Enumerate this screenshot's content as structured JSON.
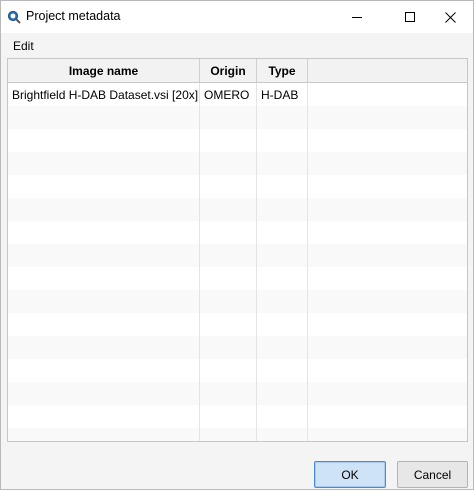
{
  "window": {
    "title": "Project metadata",
    "app_icon": "qupath-magnifier-icon"
  },
  "menu": {
    "items": [
      {
        "label": "Edit"
      }
    ]
  },
  "table": {
    "columns": [
      "Image name",
      "Origin",
      "Type",
      ""
    ],
    "rows": [
      [
        "Brightfield H-DAB Dataset.vsi [20x]",
        "OMERO",
        "H-DAB",
        ""
      ]
    ],
    "empty_rows": 15
  },
  "buttons": {
    "ok": "OK",
    "cancel": "Cancel"
  },
  "colors": {
    "accent": "#4a8ad4",
    "ok_fill": "#cfe3f7"
  }
}
